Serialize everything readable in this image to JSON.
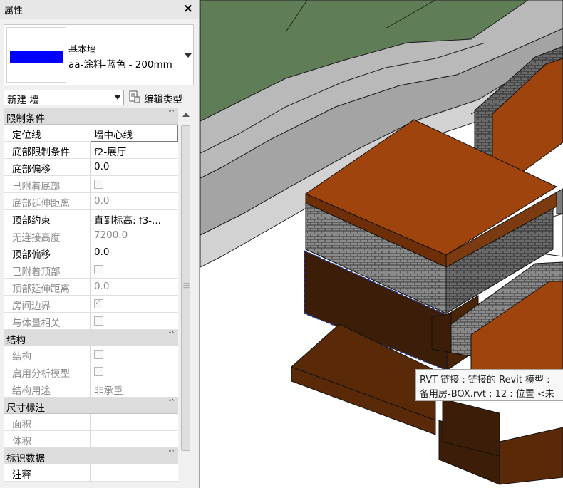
{
  "panel": {
    "title": "属性",
    "close_label": "×",
    "type_selector": {
      "family": "基本墙",
      "type_name": "aa-涂料-蓝色 - 200mm",
      "preview_color": "#0000ff"
    },
    "instance_filter": "新建 墙",
    "edit_type_label": "编辑类型",
    "categories": {
      "constraints": {
        "label": "限制条件",
        "rows": [
          {
            "name": "定位线",
            "value": "墙中心线"
          },
          {
            "name": "底部限制条件",
            "value": "f2-展厅"
          },
          {
            "name": "底部偏移",
            "value": "0.0"
          },
          {
            "name": "已附着底部",
            "value": ""
          },
          {
            "name": "底部延伸距离",
            "value": "0.0"
          },
          {
            "name": "顶部约束",
            "value": "直到标高: f3-..."
          },
          {
            "name": "无连接高度",
            "value": "7200.0"
          },
          {
            "name": "顶部偏移",
            "value": "0.0"
          },
          {
            "name": "已附着顶部",
            "value": ""
          },
          {
            "name": "顶部延伸距离",
            "value": "0.0"
          },
          {
            "name": "房间边界",
            "value": ""
          },
          {
            "name": "与体量相关",
            "value": ""
          }
        ]
      },
      "structure": {
        "label": "结构",
        "rows": [
          {
            "name": "结构",
            "value": ""
          },
          {
            "name": "启用分析模型",
            "value": ""
          },
          {
            "name": "结构用途",
            "value": "非承重"
          }
        ]
      },
      "dimensions": {
        "label": "尺寸标注",
        "rows": [
          {
            "name": "面积",
            "value": ""
          },
          {
            "name": "体积",
            "value": ""
          }
        ]
      },
      "identity": {
        "label": "标识数据",
        "rows": [
          {
            "name": "注释",
            "value": ""
          }
        ]
      }
    }
  },
  "tooltip": {
    "line1": "RVT 链接 : 链接的 Revit 模型 :",
    "line2": "备用房-BOX.rvt : 12 : 位置 <未"
  },
  "colors": {
    "roof": "#a0440e",
    "dark_wall": "#3c1d08",
    "grey_wall": "#606060",
    "terrain_green": "#5f7e57"
  }
}
